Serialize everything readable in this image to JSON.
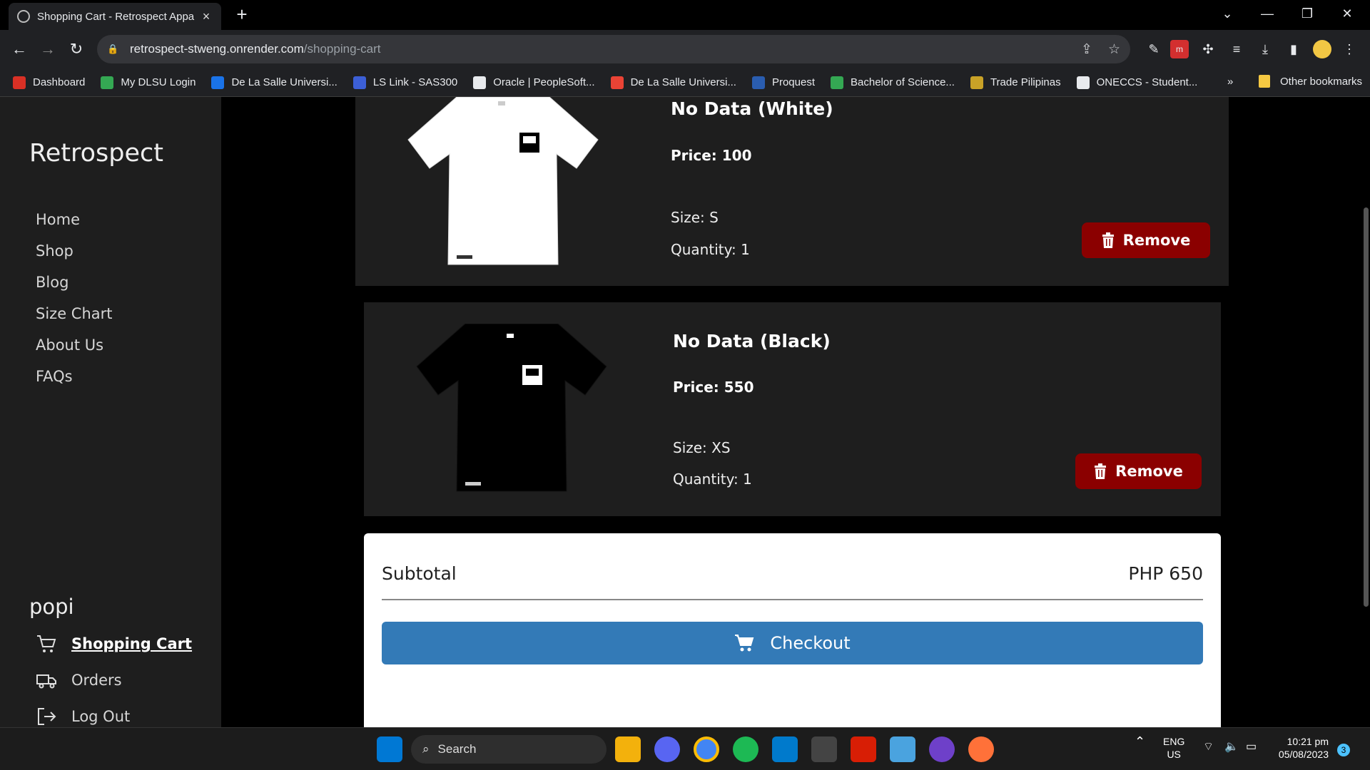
{
  "browser": {
    "tab_title": "Shopping Cart - Retrospect Appa",
    "new_tab": "+",
    "url_host": "retrospect-stweng.onrender.com",
    "url_path": "/shopping-cart",
    "bookmarks": [
      {
        "label": "Dashboard",
        "color": "#d93025"
      },
      {
        "label": "My DLSU Login",
        "color": "#34a853"
      },
      {
        "label": "De La Salle Universi...",
        "color": "#1a73e8"
      },
      {
        "label": "LS Link - SAS300",
        "color": "#3c5fd6"
      },
      {
        "label": "Oracle | PeopleSoft...",
        "color": "#e8eaed"
      },
      {
        "label": "De La Salle Universi...",
        "color": "#ea4335"
      },
      {
        "label": "Proquest",
        "color": "#2a5db0"
      },
      {
        "label": "Bachelor of Science...",
        "color": "#34a853"
      },
      {
        "label": "Trade Pilipinas",
        "color": "#c9a227"
      },
      {
        "label": "ONECCS - Student...",
        "color": "#e8eaed"
      }
    ],
    "more_bookmarks": "»",
    "other_bookmarks": "Other bookmarks"
  },
  "sidebar": {
    "brand": "Retrospect",
    "nav": [
      "Home",
      "Shop",
      "Blog",
      "Size Chart",
      "About Us",
      "FAQs"
    ],
    "username": "popi",
    "account": [
      {
        "label": "Shopping Cart",
        "icon": "cart-icon",
        "active": true
      },
      {
        "label": "Orders",
        "icon": "truck-icon",
        "active": false
      },
      {
        "label": "Log Out",
        "icon": "logout-icon",
        "active": false
      }
    ]
  },
  "cart": {
    "items": [
      {
        "name": "No Data (White)",
        "price": "Price: 100",
        "size": "Size: S",
        "quantity": "Quantity: 1",
        "shirt_color": "#ffffff",
        "remove": "Remove"
      },
      {
        "name": "No Data (Black)",
        "price": "Price: 550",
        "size": "Size: XS",
        "quantity": "Quantity: 1",
        "shirt_color": "#000000",
        "remove": "Remove"
      }
    ],
    "subtotal_label": "Subtotal",
    "subtotal_value": "PHP 650",
    "checkout_label": "Checkout"
  },
  "taskbar": {
    "search": "Search",
    "lang_1": "ENG",
    "lang_2": "US",
    "time": "10:21 pm",
    "date": "05/08/2023",
    "notifications": "3"
  },
  "colors": {
    "remove_button": "#8b0000",
    "checkout_button": "#337ab7",
    "sidebar_bg": "#1e1e1e"
  }
}
